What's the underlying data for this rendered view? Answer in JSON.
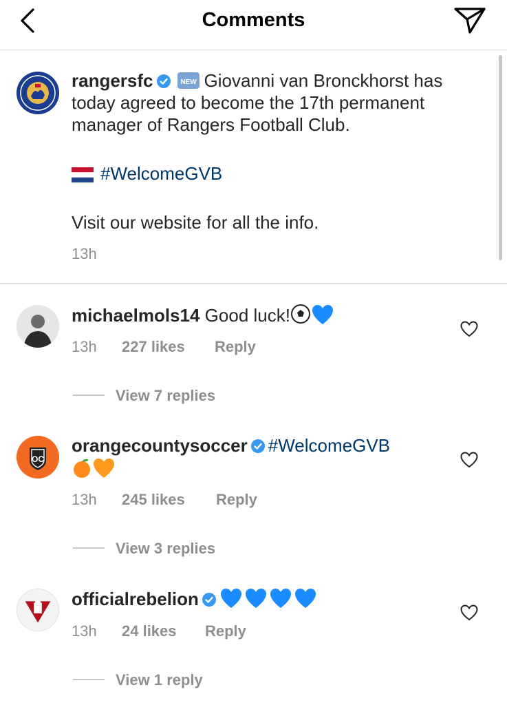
{
  "header": {
    "title": "Comments",
    "back_icon": "chevron-left-icon",
    "send_icon": "paper-plane-icon"
  },
  "post": {
    "username": "rangersfc",
    "badge_new": "NEW",
    "caption_line1": "Giovanni van Bronckhorst has",
    "caption_line2": "today agreed to become the 17th permanent",
    "caption_line3": "manager of Rangers Football Club.",
    "hashtag": "#WelcomeGVB",
    "caption_visit": "Visit our website for all the info.",
    "time": "13h"
  },
  "comments": [
    {
      "username": "michaelmols14",
      "text": "Good luck!",
      "time": "13h",
      "likes": "227 likes",
      "reply": "Reply",
      "view_replies": "View 7 replies"
    },
    {
      "username": "orangecountysoccer",
      "text": "#WelcomeGVB",
      "time": "13h",
      "likes": "245 likes",
      "reply": "Reply",
      "view_replies": "View 3 replies"
    },
    {
      "username": "officialrebelion",
      "text": "",
      "time": "13h",
      "likes": "24 likes",
      "reply": "Reply",
      "view_replies": "View 1 reply"
    }
  ],
  "colors": {
    "link": "#00376b",
    "verified": "#3897f0",
    "muted": "#8e8e8e",
    "blue_heart": "#1a8cff",
    "orange_heart": "#ff9a1f"
  }
}
